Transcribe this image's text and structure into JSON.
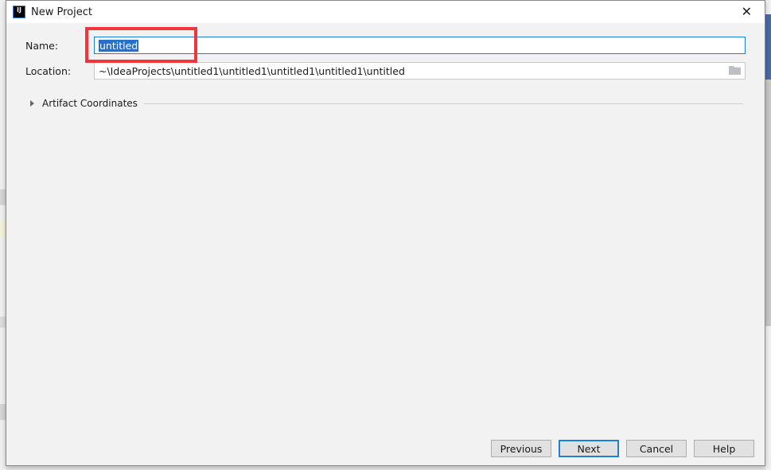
{
  "dialog": {
    "title": "New Project",
    "name_label": "Name:",
    "name_value": "untitled",
    "location_label": "Location:",
    "location_value": "~\\IdeaProjects\\untitled1\\untitled1\\untitled1\\untitled1\\untitled",
    "artifact_label": "Artifact Coordinates",
    "buttons": {
      "previous": "Previous",
      "next": "Next",
      "cancel": "Cancel",
      "help": "Help"
    },
    "logo_text": "IJ"
  },
  "colors": {
    "highlight": "#f5333b",
    "focus": "#1e7fd7",
    "selection": "#2a6fc3"
  }
}
